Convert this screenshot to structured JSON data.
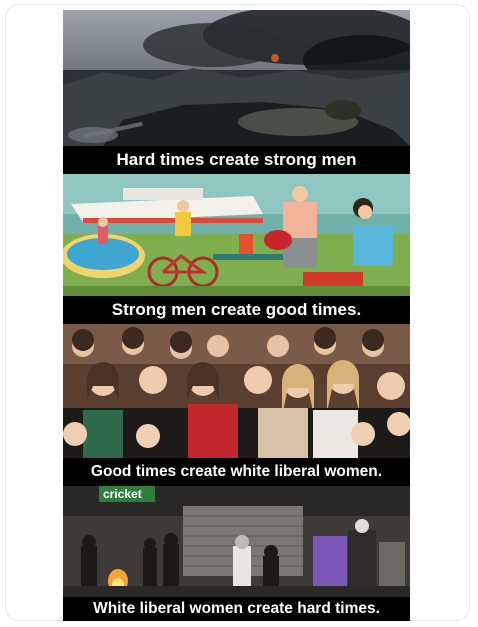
{
  "meme": {
    "captions": [
      "Hard times create strong men",
      "Strong men create good times.",
      "Good times create white liberal women.",
      "White liberal women create hard times."
    ],
    "sign_text": "cricket"
  }
}
